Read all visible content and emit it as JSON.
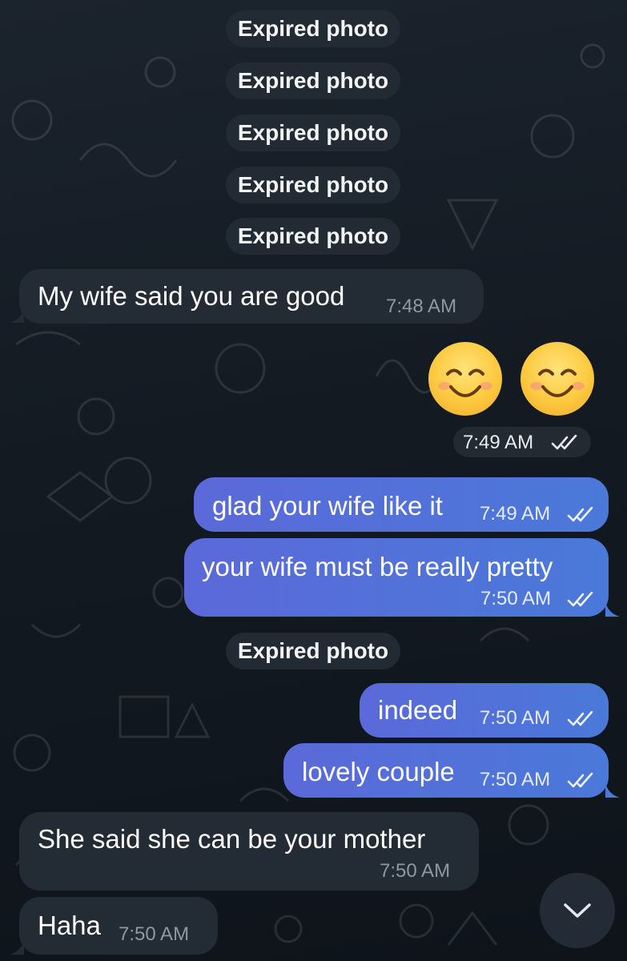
{
  "service_messages": [
    {
      "label": "Expired photo"
    },
    {
      "label": "Expired photo"
    },
    {
      "label": "Expired photo"
    },
    {
      "label": "Expired photo"
    },
    {
      "label": "Expired photo"
    },
    {
      "label": "Expired photo"
    }
  ],
  "messages": [
    {
      "direction": "incoming",
      "text": "My wife said you are good",
      "time": "7:48 AM"
    },
    {
      "direction": "outgoing",
      "type": "emoji",
      "emojis": [
        "smiling-face-with-smiling-eyes",
        "smiling-face-with-smiling-eyes"
      ],
      "time": "7:49 AM",
      "status": "read"
    },
    {
      "direction": "outgoing",
      "text": "glad your wife like it",
      "time": "7:49 AM",
      "status": "read"
    },
    {
      "direction": "outgoing",
      "text": "your wife must be really pretty",
      "time": "7:50 AM",
      "status": "read"
    },
    {
      "direction": "outgoing",
      "text": "indeed",
      "time": "7:50 AM",
      "status": "read"
    },
    {
      "direction": "outgoing",
      "text": "lovely couple",
      "time": "7:50 AM",
      "status": "read"
    },
    {
      "direction": "incoming",
      "text": "She said she can be your mother",
      "time": "7:50 AM"
    },
    {
      "direction": "incoming",
      "text": "Haha",
      "time": "7:50 AM"
    }
  ],
  "icons": {
    "read_status": "double-check-icon",
    "scroll_down": "chevron-down-icon"
  },
  "colors": {
    "background": "#161d25",
    "incoming_bubble": "#232b35",
    "outgoing_bubble_start": "#5b69d9",
    "outgoing_bubble_end": "#4a79d9",
    "service_pill": "#222b34"
  }
}
